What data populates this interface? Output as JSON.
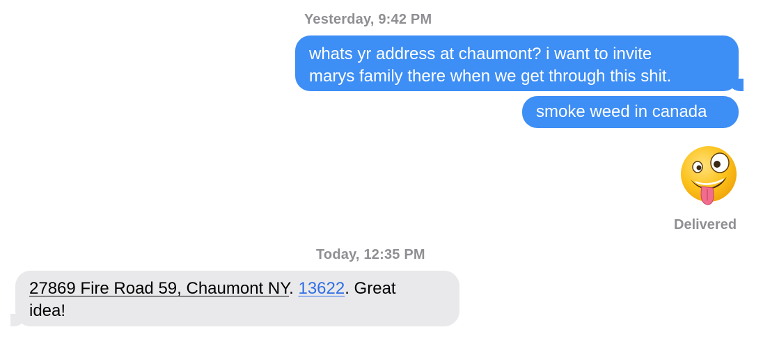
{
  "thread": {
    "timestamp_1": "Yesterday, 9:42 PM",
    "timestamp_2": "Today, 12:35 PM",
    "delivered_label": "Delivered"
  },
  "messages": {
    "sent_1_line_1": "whats yr address at chaumont? i want to invite",
    "sent_1_line_2": "marys family there when we get through this shit.",
    "sent_2": "smoke weed in canada",
    "sent_3_emoji": "zany-face-emoji",
    "received_1": {
      "address": "27869 Fire Road 59, Chaumont NY",
      "sep": ". ",
      "zip": "13622",
      "rest_line_1": ". Great",
      "rest_line_2": "idea!"
    }
  },
  "colors": {
    "sent_bubble": "#3d8ef5",
    "received_bubble": "#e9e9eb",
    "link": "#2f6ee6",
    "meta_text": "#8e8e93"
  }
}
